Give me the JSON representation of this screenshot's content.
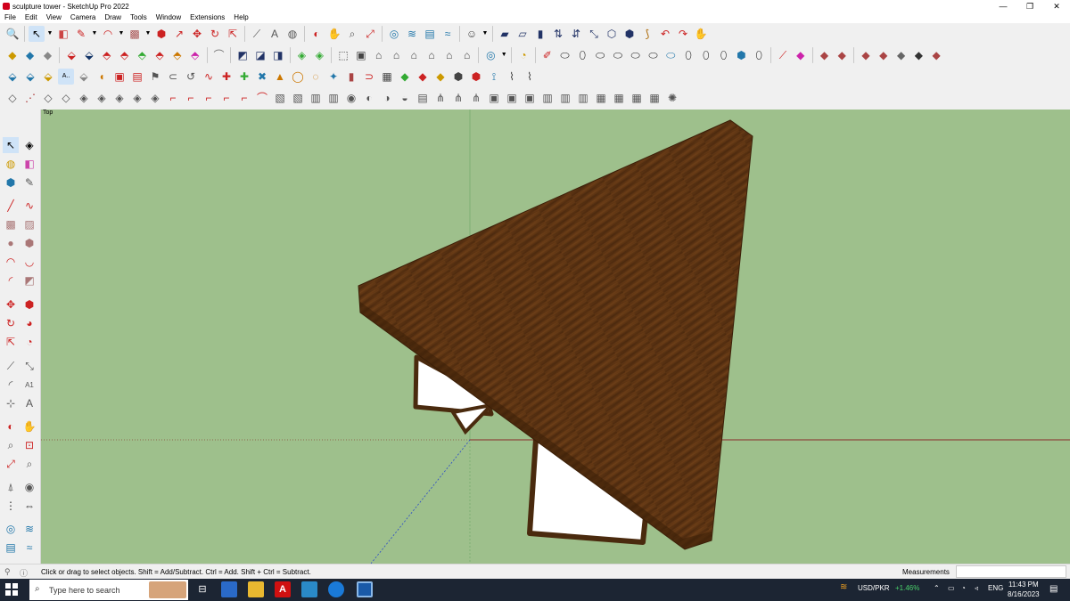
{
  "window": {
    "title": "sculpture tower - SketchUp Pro 2022",
    "minimize": "—",
    "maximize": "❐",
    "close": "✕"
  },
  "menu": [
    "File",
    "Edit",
    "View",
    "Camera",
    "Draw",
    "Tools",
    "Window",
    "Extensions",
    "Help"
  ],
  "viewport": {
    "scene_label": "Top",
    "background": "#9ec08c",
    "wood_color": "#5a3312"
  },
  "status": {
    "hint": "Click or drag to select objects. Shift = Add/Subtract. Ctrl = Add. Shift + Ctrl = Subtract.",
    "measurements_label": "Measurements",
    "measurements_value": ""
  },
  "taskbar": {
    "search_placeholder": "Type here to search",
    "currency_pair": "USD/PKR",
    "currency_change": "+1.46%",
    "language": "ENG",
    "time": "11:43 PM",
    "date": "8/16/2023"
  }
}
